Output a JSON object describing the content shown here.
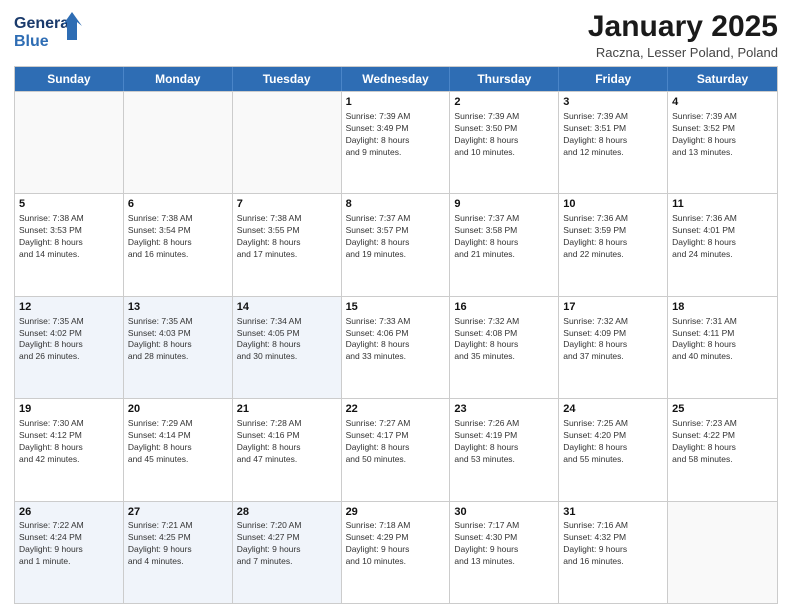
{
  "logo": {
    "line1": "General",
    "line2": "Blue"
  },
  "title": "January 2025",
  "location": "Raczna, Lesser Poland, Poland",
  "weekdays": [
    "Sunday",
    "Monday",
    "Tuesday",
    "Wednesday",
    "Thursday",
    "Friday",
    "Saturday"
  ],
  "rows": [
    [
      {
        "day": "",
        "info": ""
      },
      {
        "day": "",
        "info": ""
      },
      {
        "day": "",
        "info": ""
      },
      {
        "day": "1",
        "info": "Sunrise: 7:39 AM\nSunset: 3:49 PM\nDaylight: 8 hours\nand 9 minutes."
      },
      {
        "day": "2",
        "info": "Sunrise: 7:39 AM\nSunset: 3:50 PM\nDaylight: 8 hours\nand 10 minutes."
      },
      {
        "day": "3",
        "info": "Sunrise: 7:39 AM\nSunset: 3:51 PM\nDaylight: 8 hours\nand 12 minutes."
      },
      {
        "day": "4",
        "info": "Sunrise: 7:39 AM\nSunset: 3:52 PM\nDaylight: 8 hours\nand 13 minutes."
      }
    ],
    [
      {
        "day": "5",
        "info": "Sunrise: 7:38 AM\nSunset: 3:53 PM\nDaylight: 8 hours\nand 14 minutes."
      },
      {
        "day": "6",
        "info": "Sunrise: 7:38 AM\nSunset: 3:54 PM\nDaylight: 8 hours\nand 16 minutes."
      },
      {
        "day": "7",
        "info": "Sunrise: 7:38 AM\nSunset: 3:55 PM\nDaylight: 8 hours\nand 17 minutes."
      },
      {
        "day": "8",
        "info": "Sunrise: 7:37 AM\nSunset: 3:57 PM\nDaylight: 8 hours\nand 19 minutes."
      },
      {
        "day": "9",
        "info": "Sunrise: 7:37 AM\nSunset: 3:58 PM\nDaylight: 8 hours\nand 21 minutes."
      },
      {
        "day": "10",
        "info": "Sunrise: 7:36 AM\nSunset: 3:59 PM\nDaylight: 8 hours\nand 22 minutes."
      },
      {
        "day": "11",
        "info": "Sunrise: 7:36 AM\nSunset: 4:01 PM\nDaylight: 8 hours\nand 24 minutes."
      }
    ],
    [
      {
        "day": "12",
        "info": "Sunrise: 7:35 AM\nSunset: 4:02 PM\nDaylight: 8 hours\nand 26 minutes."
      },
      {
        "day": "13",
        "info": "Sunrise: 7:35 AM\nSunset: 4:03 PM\nDaylight: 8 hours\nand 28 minutes."
      },
      {
        "day": "14",
        "info": "Sunrise: 7:34 AM\nSunset: 4:05 PM\nDaylight: 8 hours\nand 30 minutes."
      },
      {
        "day": "15",
        "info": "Sunrise: 7:33 AM\nSunset: 4:06 PM\nDaylight: 8 hours\nand 33 minutes."
      },
      {
        "day": "16",
        "info": "Sunrise: 7:32 AM\nSunset: 4:08 PM\nDaylight: 8 hours\nand 35 minutes."
      },
      {
        "day": "17",
        "info": "Sunrise: 7:32 AM\nSunset: 4:09 PM\nDaylight: 8 hours\nand 37 minutes."
      },
      {
        "day": "18",
        "info": "Sunrise: 7:31 AM\nSunset: 4:11 PM\nDaylight: 8 hours\nand 40 minutes."
      }
    ],
    [
      {
        "day": "19",
        "info": "Sunrise: 7:30 AM\nSunset: 4:12 PM\nDaylight: 8 hours\nand 42 minutes."
      },
      {
        "day": "20",
        "info": "Sunrise: 7:29 AM\nSunset: 4:14 PM\nDaylight: 8 hours\nand 45 minutes."
      },
      {
        "day": "21",
        "info": "Sunrise: 7:28 AM\nSunset: 4:16 PM\nDaylight: 8 hours\nand 47 minutes."
      },
      {
        "day": "22",
        "info": "Sunrise: 7:27 AM\nSunset: 4:17 PM\nDaylight: 8 hours\nand 50 minutes."
      },
      {
        "day": "23",
        "info": "Sunrise: 7:26 AM\nSunset: 4:19 PM\nDaylight: 8 hours\nand 53 minutes."
      },
      {
        "day": "24",
        "info": "Sunrise: 7:25 AM\nSunset: 4:20 PM\nDaylight: 8 hours\nand 55 minutes."
      },
      {
        "day": "25",
        "info": "Sunrise: 7:23 AM\nSunset: 4:22 PM\nDaylight: 8 hours\nand 58 minutes."
      }
    ],
    [
      {
        "day": "26",
        "info": "Sunrise: 7:22 AM\nSunset: 4:24 PM\nDaylight: 9 hours\nand 1 minute."
      },
      {
        "day": "27",
        "info": "Sunrise: 7:21 AM\nSunset: 4:25 PM\nDaylight: 9 hours\nand 4 minutes."
      },
      {
        "day": "28",
        "info": "Sunrise: 7:20 AM\nSunset: 4:27 PM\nDaylight: 9 hours\nand 7 minutes."
      },
      {
        "day": "29",
        "info": "Sunrise: 7:18 AM\nSunset: 4:29 PM\nDaylight: 9 hours\nand 10 minutes."
      },
      {
        "day": "30",
        "info": "Sunrise: 7:17 AM\nSunset: 4:30 PM\nDaylight: 9 hours\nand 13 minutes."
      },
      {
        "day": "31",
        "info": "Sunrise: 7:16 AM\nSunset: 4:32 PM\nDaylight: 9 hours\nand 16 minutes."
      },
      {
        "day": "",
        "info": ""
      }
    ]
  ]
}
